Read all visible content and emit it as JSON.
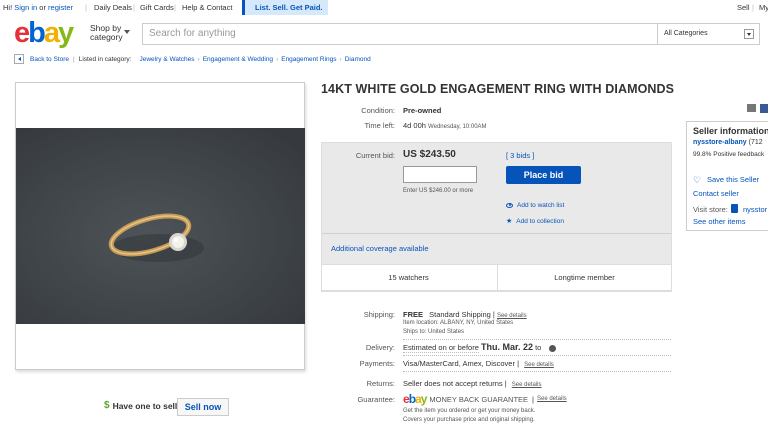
{
  "topbar": {
    "greeting_prefix": "Hi! ",
    "sign_in": "Sign in",
    "or": " or ",
    "register": "register",
    "daily_deals": "Daily Deals",
    "gift_cards": "Gift Cards",
    "help_contact": "Help & Contact",
    "promo": "List. Sell. Get Paid.",
    "sell": "Sell",
    "my": "My"
  },
  "header": {
    "logo_letters": [
      "e",
      "b",
      "a",
      "y"
    ],
    "shop_by_line1": "Shop by",
    "shop_by_line2": "category",
    "search_placeholder": "Search for anything",
    "category_selected": "All Categories"
  },
  "breadcrumb": {
    "back": "Back to Store",
    "listed_in": "Listed in category:",
    "items": [
      "Jewelry & Watches",
      "Engagement & Wedding",
      "Engagement Rings",
      "Diamond"
    ]
  },
  "listing": {
    "title": "14KT WHITE GOLD ENGAGEMENT RING WITH DIAMONDS",
    "condition_label": "Condition:",
    "condition_value": "Pre-owned",
    "time_left_label": "Time left:",
    "time_left_value": "4d 00h",
    "time_left_detail": "Wednesday, 10:00AM",
    "current_bid_label": "Current bid:",
    "current_bid_value": "US $243.50",
    "bids_link": "[ 3 bids ]",
    "place_bid": "Place bid",
    "enter_hint": "Enter US $246.00 or more",
    "watch_list": "Add to watch list",
    "add_collection": "Add to collection",
    "additional_coverage": "Additional coverage available",
    "watchers": "15 watchers",
    "longtime_member": "Longtime member"
  },
  "shipping": {
    "shipping_label": "Shipping:",
    "shipping_free": "FREE",
    "shipping_method": "Standard Shipping |",
    "see_details": "See details",
    "item_location": "Item location:  ALBANY, NY, United States",
    "ships_to": "Ships to:  United States",
    "delivery_label": "Delivery:",
    "delivery_prefix": "Estimated on or before",
    "delivery_date": "Thu. Mar. 22",
    "delivery_to": "to",
    "payments_label": "Payments:",
    "payments_value": "Visa/MasterCard, Amex, Discover  |",
    "returns_label": "Returns:",
    "returns_value": "Seller does not accept returns  |",
    "guarantee_label": "Guarantee:",
    "guarantee_text": "MONEY BACK GUARANTEE",
    "guarantee_sep": "|",
    "guarantee_line1": "Get the item you ordered or get your money back.",
    "guarantee_line2": "Covers your purchase price and original shipping."
  },
  "seller": {
    "heading": "Seller information",
    "name": "nysstore-albany",
    "score": "(712",
    "feedback": "99.8% Positive feedback",
    "save": "Save this Seller",
    "contact": "Contact seller",
    "visit_store": "Visit store:",
    "store_name": "nysstor",
    "see_other": "See other items"
  },
  "sell_promo": {
    "question": "Have one to sell?",
    "button": "Sell now"
  },
  "colors": {
    "link": "#0654ba",
    "ebay_red": "#e53238",
    "ebay_blue": "#0064d2",
    "ebay_yellow": "#f5af02",
    "ebay_green": "#86b817"
  }
}
